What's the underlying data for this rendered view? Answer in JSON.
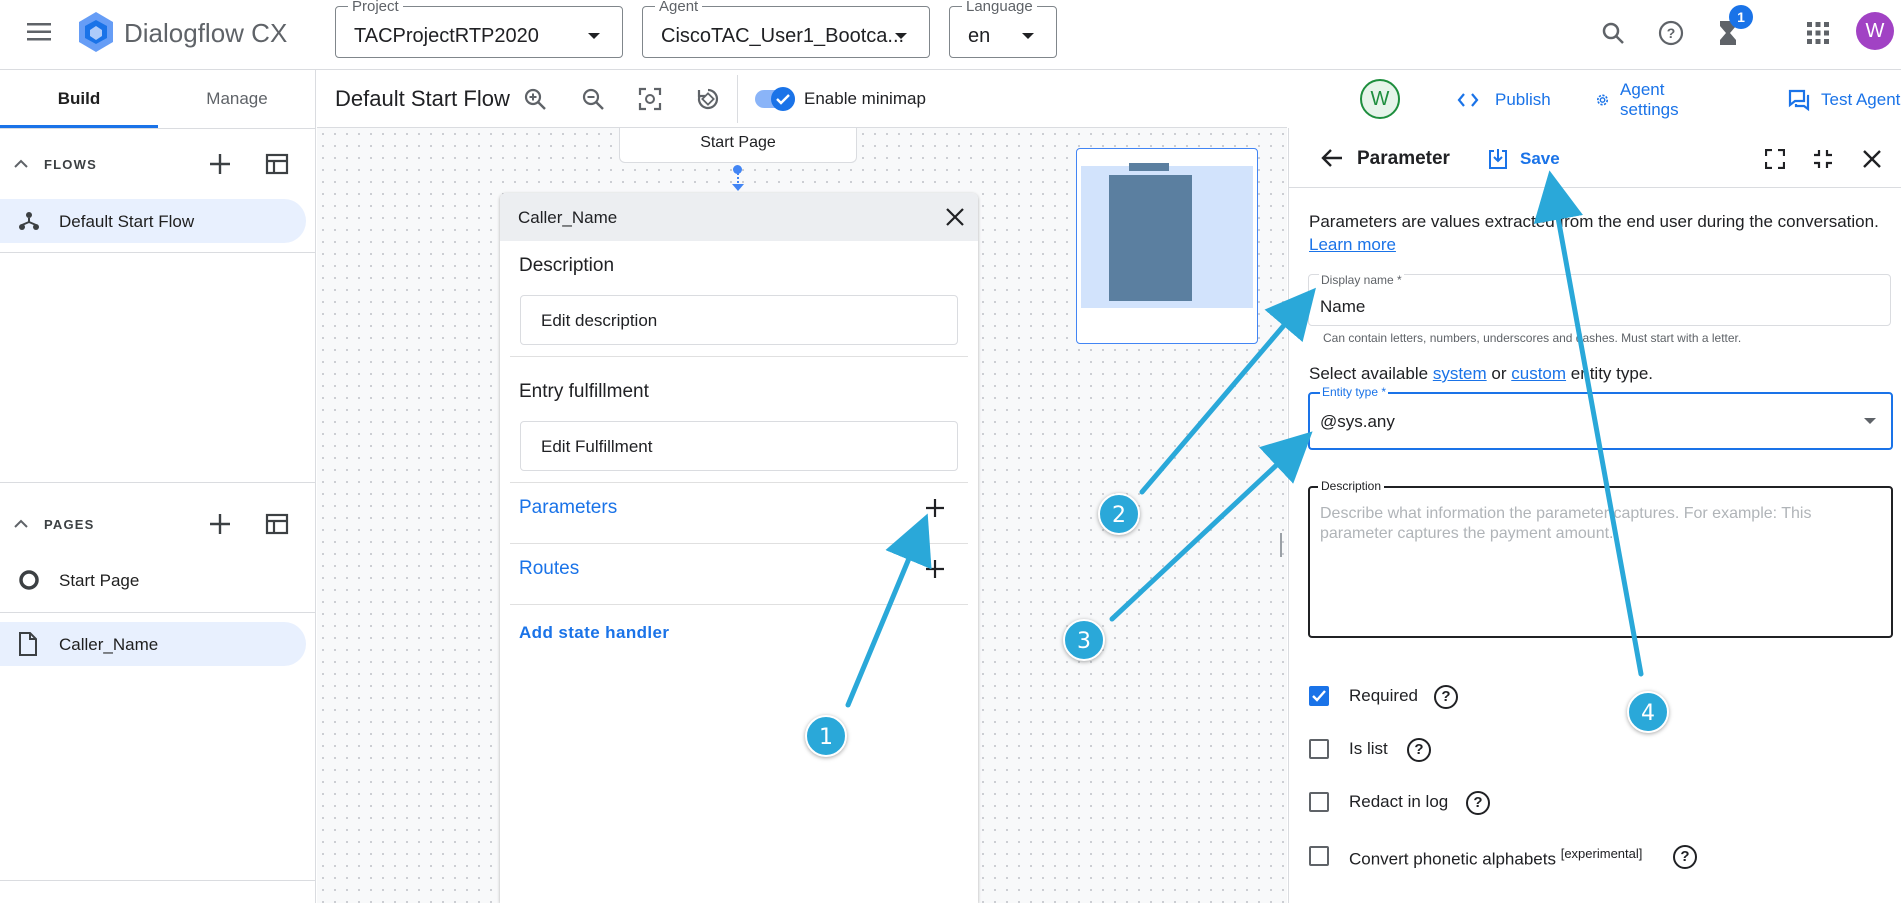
{
  "app": {
    "title": "Dialogflow CX"
  },
  "topbar": {
    "project": {
      "label": "Project",
      "value": "TACProjectRTP2020"
    },
    "agent": {
      "label": "Agent",
      "value": "CiscoTAC_User1_Bootca..."
    },
    "language": {
      "label": "Language",
      "value": "en"
    },
    "notification_count": "1",
    "avatar_letter": "W"
  },
  "leftnav": {
    "tabs": [
      {
        "label": "Build"
      },
      {
        "label": "Manage"
      }
    ],
    "flows": {
      "title": "FLOWS",
      "items": [
        {
          "label": "Default Start Flow"
        }
      ]
    },
    "pages": {
      "title": "PAGES",
      "items": [
        {
          "label": "Start Page"
        },
        {
          "label": "Caller_Name"
        }
      ]
    }
  },
  "toolbar": {
    "flow_title": "Default Start Flow",
    "minimap_label": "Enable minimap",
    "user_avatar": "W",
    "publish": "Publish",
    "agent_settings": "Agent settings",
    "test_agent": "Test Agent"
  },
  "canvas": {
    "start_page_node": "Start Page",
    "card": {
      "title": "Caller_Name",
      "description_heading": "Description",
      "edit_description": "Edit description",
      "entry_heading": "Entry fulfillment",
      "edit_fulfillment": "Edit Fulfillment",
      "parameters": "Parameters",
      "routes": "Routes",
      "add_state_handler": "Add state handler"
    }
  },
  "panel": {
    "title": "Parameter",
    "save": "Save",
    "intro": "Parameters are values extracted from the end user during the conversation.",
    "learn_more": "Learn more",
    "display_name": {
      "label": "Display name *",
      "value": "Name",
      "hint": "Can contain letters, numbers, underscores and dashes. Must start with a letter."
    },
    "entity_intro": {
      "prefix": "Select available",
      "system": "system",
      "or": "or",
      "custom": "custom",
      "suffix": "entity type."
    },
    "entity_type": {
      "label": "Entity type *",
      "value": "@sys.any"
    },
    "description": {
      "label": "Description",
      "placeholder": "Describe what information the parameter captures. For example: This parameter captures the payment amount."
    },
    "options": [
      {
        "label": "Required",
        "checked": true
      },
      {
        "label": "Is list",
        "checked": false
      },
      {
        "label": "Redact in log",
        "checked": false
      },
      {
        "label": "Convert phonetic alphabets",
        "sup": "[experimental]",
        "checked": false
      }
    ]
  },
  "annotations": {
    "m1": "1",
    "m2": "2",
    "m3": "3",
    "m4": "4"
  },
  "colors": {
    "accent": "#1a73e8",
    "marker": "#2aa8d9",
    "selected_nav": "#e8f0fe",
    "avatar": "#a142c4"
  }
}
